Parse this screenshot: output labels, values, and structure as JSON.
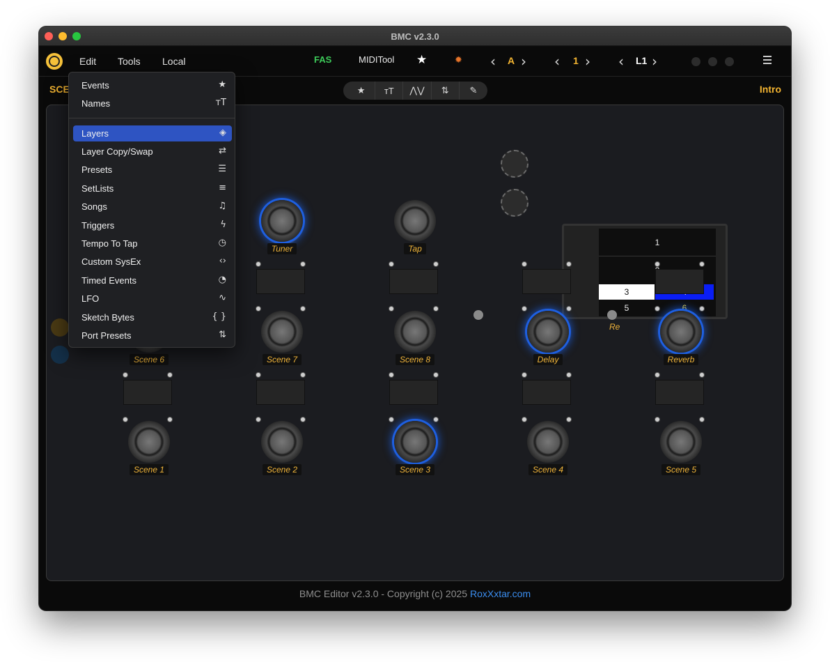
{
  "window": {
    "title": "BMC v2.3.0"
  },
  "menubar": {
    "menus": [
      "Edit",
      "Tools",
      "Local"
    ],
    "fas": "FAS",
    "miditool": "MIDITool",
    "bank": "A",
    "page": "1",
    "layer": "L1"
  },
  "subbar": {
    "left": "SCE",
    "right": "Intro"
  },
  "toolbar_icons": [
    "star-icon",
    "names-icon",
    "lfo-icon",
    "port-presets-icon",
    "edit-icon"
  ],
  "panel": {
    "footswitch_labels": {
      "tuner": "Tuner",
      "tap": "Tap",
      "scene6": "Scene 6",
      "scene7": "Scene 7",
      "scene8": "Scene 8",
      "delay": "Delay",
      "reverb": "Reverb",
      "scene1": "Scene 1",
      "scene2": "Scene 2",
      "scene3": "Scene 3",
      "scene4": "Scene 4",
      "scene5": "Scene 5"
    },
    "re_label": "Re",
    "lcd": {
      "cells": [
        "1",
        "2",
        "3",
        "4",
        "5",
        "6"
      ]
    },
    "lit_switches": [
      "Tuner",
      "Delay",
      "Reverb",
      "Scene 3"
    ]
  },
  "edit_menu": {
    "items": [
      {
        "label": "Events",
        "icon": "star-icon"
      },
      {
        "label": "Names",
        "icon": "text-size-icon"
      },
      {
        "label": "Layers",
        "icon": "layers-icon",
        "selected": true
      },
      {
        "label": "Layer Copy/Swap",
        "icon": "swap-icon"
      },
      {
        "label": "Presets",
        "icon": "sliders-icon"
      },
      {
        "label": "SetLists",
        "icon": "list-music-icon"
      },
      {
        "label": "Songs",
        "icon": "song-icon"
      },
      {
        "label": "Triggers",
        "icon": "lightning-icon"
      },
      {
        "label": "Tempo To Tap",
        "icon": "tempo-icon"
      },
      {
        "label": "Custom SysEx",
        "icon": "code-icon"
      },
      {
        "label": "Timed Events",
        "icon": "stopwatch-icon"
      },
      {
        "label": "LFO",
        "icon": "waveform-icon"
      },
      {
        "label": "Sketch Bytes",
        "icon": "braces-icon"
      },
      {
        "label": "Port Presets",
        "icon": "port-icon"
      }
    ]
  },
  "footer": {
    "text": "BMC Editor v2.3.0 - Copyright (c) 2025",
    "link": "RoxXxtar.com"
  },
  "colors": {
    "accent": "#f3b431",
    "selection": "#2e54c2",
    "fas": "#3dcc5a",
    "link": "#3b8ef0",
    "lcd_blue": "#0a1ef5"
  }
}
